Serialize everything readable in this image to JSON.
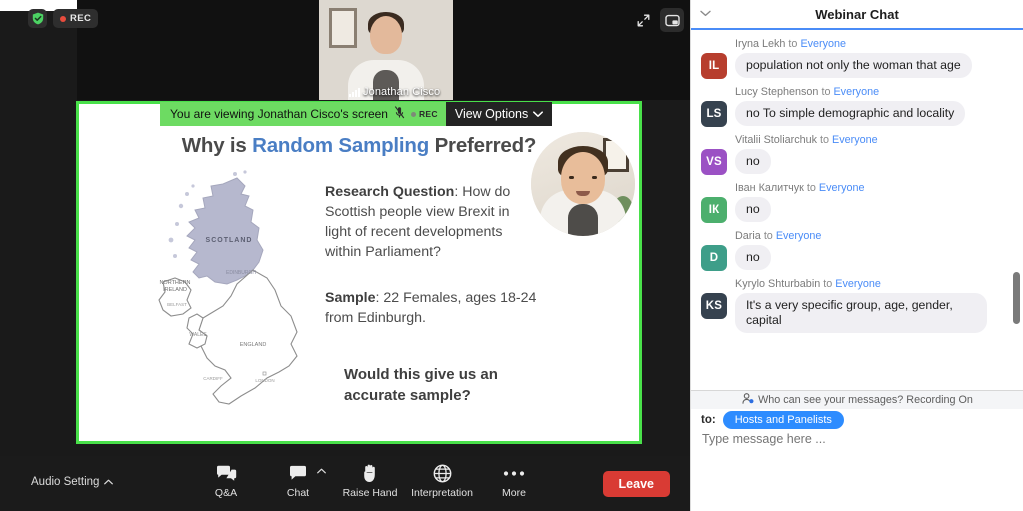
{
  "meeting": {
    "shield_icon": "shield-check-icon",
    "rec_label": "REC",
    "expand_icon": "expand-arrows-icon",
    "pip_icon": "picture-in-picture-icon",
    "self_view": {
      "participant_name": "Jonathan Cisco",
      "audio_icon": "audio-bars-icon"
    },
    "share_bar": {
      "viewing_text": "You are viewing Jonathan Cisco's screen",
      "mute_icon": "microphone-muted-icon",
      "rec_label": "REC",
      "view_options_label": "View Options",
      "view_options_icon": "chevron-down-icon",
      "banner_color": "#6ddb62",
      "border_color": "#49e04a"
    },
    "toolbar": {
      "audio_setting_label": "Audio Setting",
      "audio_setting_icon": "chevron-up-icon",
      "items": [
        {
          "label": "Q&A",
          "icon": "qa-bubbles-icon",
          "caret": false
        },
        {
          "label": "Chat",
          "icon": "chat-bubble-icon",
          "caret": true
        },
        {
          "label": "Raise Hand",
          "icon": "raise-hand-icon",
          "caret": false
        },
        {
          "label": "Interpretation",
          "icon": "globe-icon",
          "caret": false
        },
        {
          "label": "More",
          "icon": "ellipsis-icon",
          "caret": false
        }
      ],
      "leave_label": "Leave",
      "leave_color": "#d93b34"
    }
  },
  "slide": {
    "title_before": "Why is ",
    "title_highlight": "Random Sampling",
    "title_after": " Preferred?",
    "highlight_color": "#4a7ec4",
    "research_question_label": "Research Question",
    "research_question_text": ": How do Scottish people view Brexit in light of recent developments within Parliament?",
    "sample_label": "Sample",
    "sample_text": ": 22 Females, ages 18-24 from Edinburgh.",
    "closing_question": "Would this give us an accurate sample?",
    "map": {
      "icon": "uk-map-icon",
      "highlighted_region": "Scotland",
      "highlight_color": "#b6b8ce",
      "labels": [
        "SCOTLAND",
        "EDINBURGH",
        "NORTHERN IRELAND",
        "BELFAST",
        "WALES",
        "ENGLAND",
        "LONDON",
        "CARDIFF"
      ]
    }
  },
  "chat": {
    "title": "Webinar Chat",
    "collapse_icon": "chevron-down-icon",
    "to_word": "to",
    "messages": [
      {
        "sender": "Iryna Lekh",
        "recipient": "Everyone",
        "initials": "IL",
        "color": "#b73e2e",
        "text": "population not only the woman that age"
      },
      {
        "sender": "Lucy Stephenson",
        "recipient": "Everyone",
        "initials": "LS",
        "color": "#36424f",
        "text": "no To simple demographic and locality"
      },
      {
        "sender": "Vitalii Stoliarchuk",
        "recipient": "Everyone",
        "initials": "VS",
        "color": "#9b51c4",
        "text": "no"
      },
      {
        "sender": "Іван Калитчук",
        "recipient": "Everyone",
        "initials": "ІК",
        "color": "#4caf6d",
        "text": "no"
      },
      {
        "sender": "Daria",
        "recipient": "Everyone",
        "initials": "D",
        "color": "#3e9e89",
        "text": "no"
      },
      {
        "sender": "Kyrylo Shturbabin",
        "recipient": "Everyone",
        "initials": "KS",
        "color": "#36424f",
        "text": "It's a very specific group, age, gender, capital"
      }
    ],
    "notice_icon": "person-check-icon",
    "notice_text": "Who can see your messages? Recording On",
    "to_label": "to:",
    "to_pill": "Hosts and Panelists",
    "to_pill_color": "#2d8cff",
    "input_placeholder": "Type message here ..."
  }
}
